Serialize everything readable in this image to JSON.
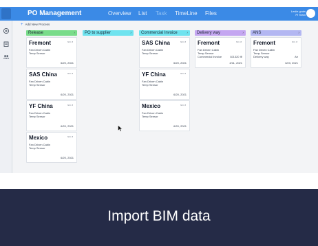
{
  "app": {
    "title": "PO Management",
    "nav": [
      "Overview",
      "List",
      "Task",
      "TimeLine",
      "Files"
    ],
    "active_nav": "Task",
    "user": {
      "line1": "Leslie goals",
      "line2": "PI Team"
    },
    "accent": "#3b8ae6"
  },
  "sidebar": {
    "icons": [
      "add-icon",
      "document-icon",
      "people-icon"
    ]
  },
  "toolbar": {
    "add_label": "Add New Process"
  },
  "columns": [
    {
      "name": "Release",
      "color": "#79dc8a",
      "cards": [
        {
          "title": "Fremont",
          "badge": "NO. 8",
          "lines": [
            "Fan Driven Cabin",
            "Temp Sensor"
          ],
          "date": "6/20, 2021"
        },
        {
          "title": "SAS China",
          "badge": "NO. 8",
          "lines": [
            "Fan Driven Cabin",
            "Temp Sensor"
          ],
          "date": "6/20, 2021"
        },
        {
          "title": "YF China",
          "badge": "NO. 8",
          "lines": [
            "Fan Driven Cabin",
            "Temp Sensor"
          ],
          "date": "6/20, 2021"
        },
        {
          "title": "Mexico",
          "badge": "NO. 8",
          "lines": [
            "Fan Driven Cabin",
            "Temp Sensor"
          ],
          "date": "6/20, 2021"
        }
      ]
    },
    {
      "name": "PO to supplier",
      "color": "#6fe3ef",
      "cards": []
    },
    {
      "name": "Commercial Invoice",
      "color": "#6fe3ef",
      "cards": [
        {
          "title": "SAS China",
          "badge": "NO. 8",
          "lines": [
            "Fan Driven Cabin",
            "Temp Sensor"
          ],
          "date": "6/20, 2021"
        },
        {
          "title": "YF China",
          "badge": "NO. 8",
          "lines": [
            "Fan Driven Cabin",
            "Temp Sensor"
          ],
          "date": "6/20, 2021"
        },
        {
          "title": "Mexico",
          "badge": "NO. 8",
          "lines": [
            "Fan Driven Cabin",
            "Temp Sensor"
          ],
          "date": "6/20, 2021"
        }
      ]
    },
    {
      "name": "Delivery way",
      "color": "#c4a6f1",
      "cards": [
        {
          "title": "Fremont",
          "badge": "NO. 8",
          "lines": [
            "Fan Driven Cabin",
            "Temp Sensor"
          ],
          "row": {
            "label": "Commercial Invoice",
            "value": "021320 ⊕"
          },
          "date": "4/11, 2021"
        }
      ]
    },
    {
      "name": "ANS",
      "color": "#b3b7f2",
      "cards": [
        {
          "title": "Fremont",
          "badge": "NO. 8",
          "lines": [
            "Fan Driven Cabin",
            "Temp Sensor"
          ],
          "row": {
            "label": "Delivery way",
            "value": "Air"
          },
          "date": "3/23, 2021"
        }
      ]
    }
  ],
  "banner": {
    "title": "Import BIM data",
    "bg": "#252b47"
  }
}
